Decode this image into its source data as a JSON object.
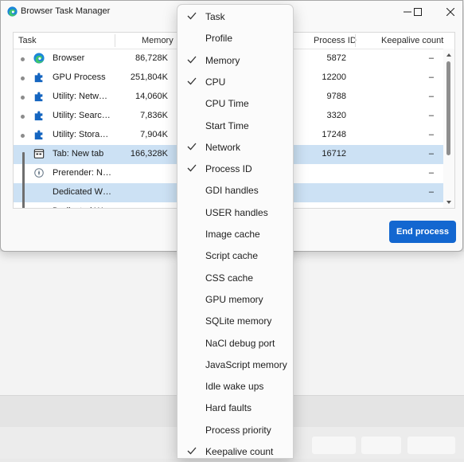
{
  "window": {
    "title": "Browser Task Manager",
    "brand_color": "#1367d0"
  },
  "table": {
    "columns": [
      "Task",
      "Memory",
      "Process ID",
      "Keepalive count"
    ],
    "rows": [
      {
        "task": "Browser",
        "memory": "86,728K",
        "pid": "5872",
        "keepalive": "–",
        "icon": "edge-icon",
        "selected": false
      },
      {
        "task": "GPU Process",
        "memory": "251,804K",
        "pid": "12200",
        "keepalive": "–",
        "icon": "puzzle-icon",
        "selected": false
      },
      {
        "task": "Utility: Netw…",
        "memory": "14,060K",
        "pid": "9788",
        "keepalive": "–",
        "icon": "puzzle-icon",
        "selected": false
      },
      {
        "task": "Utility: Searc…",
        "memory": "7,836K",
        "pid": "3320",
        "keepalive": "–",
        "icon": "puzzle-icon",
        "selected": false
      },
      {
        "task": "Utility: Stora…",
        "memory": "7,904K",
        "pid": "17248",
        "keepalive": "–",
        "icon": "puzzle-icon",
        "selected": false
      },
      {
        "task": "Tab: New tab",
        "memory": "166,328K",
        "pid": "16712",
        "keepalive": "–",
        "icon": "tab-icon",
        "selected": true
      },
      {
        "task": "Prerender: N…",
        "memory": "",
        "pid": "",
        "keepalive": "–",
        "icon": "prerender-icon",
        "selected": false
      },
      {
        "task": "Dedicated W…",
        "memory": "",
        "pid": "",
        "keepalive": "–",
        "icon": "",
        "selected": true
      },
      {
        "task": "Dedicated W…",
        "memory": "",
        "pid": "",
        "keepalive": "",
        "icon": "",
        "selected": false
      }
    ]
  },
  "actions": {
    "end_process": "End process"
  },
  "context_menu": {
    "items": [
      {
        "label": "Task",
        "checked": true
      },
      {
        "label": "Profile",
        "checked": false
      },
      {
        "label": "Memory",
        "checked": true
      },
      {
        "label": "CPU",
        "checked": true
      },
      {
        "label": "CPU Time",
        "checked": false
      },
      {
        "label": "Start Time",
        "checked": false
      },
      {
        "label": "Network",
        "checked": true
      },
      {
        "label": "Process ID",
        "checked": true
      },
      {
        "label": "GDI handles",
        "checked": false
      },
      {
        "label": "USER handles",
        "checked": false
      },
      {
        "label": "Image cache",
        "checked": false
      },
      {
        "label": "Script cache",
        "checked": false
      },
      {
        "label": "CSS cache",
        "checked": false
      },
      {
        "label": "GPU memory",
        "checked": false
      },
      {
        "label": "SQLite memory",
        "checked": false
      },
      {
        "label": "NaCl debug port",
        "checked": false
      },
      {
        "label": "JavaScript memory",
        "checked": false
      },
      {
        "label": "Idle wake ups",
        "checked": false
      },
      {
        "label": "Hard faults",
        "checked": false
      },
      {
        "label": "Process priority",
        "checked": false
      },
      {
        "label": "Keepalive count",
        "checked": true
      }
    ]
  }
}
